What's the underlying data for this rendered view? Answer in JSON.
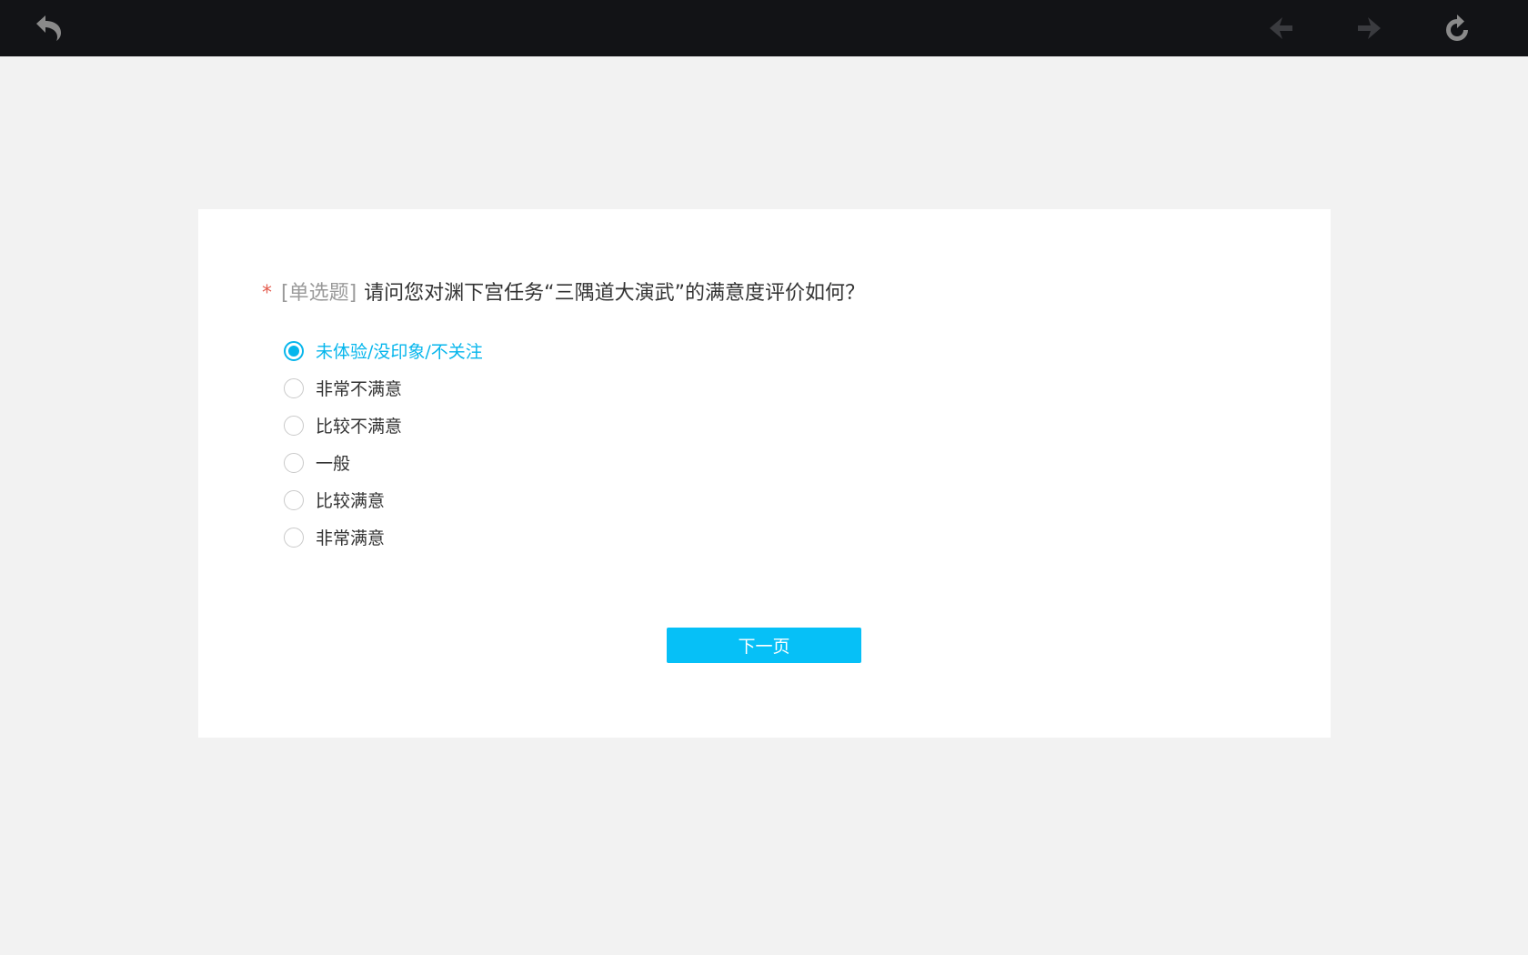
{
  "toolbar": {
    "back_icon": "undo-arrow-icon",
    "prev_icon": "arrow-left-icon",
    "next_icon": "arrow-right-icon",
    "refresh_icon": "refresh-icon",
    "background_color": "#121316"
  },
  "question": {
    "required_mark": "*",
    "type_label": "[单选题]",
    "text": "请问您对渊下宫任务“三隅道大演武”的满意度评价如何？",
    "options": [
      {
        "label": "未体验/没印象/不关注",
        "selected": true
      },
      {
        "label": "非常不满意",
        "selected": false
      },
      {
        "label": "比较不满意",
        "selected": false
      },
      {
        "label": "一般",
        "selected": false
      },
      {
        "label": "比较满意",
        "selected": false
      },
      {
        "label": "非常满意",
        "selected": false
      }
    ]
  },
  "next_button": {
    "label": "下一页"
  },
  "colors": {
    "accent": "#06c0f7",
    "required": "#e45d4f",
    "page_background": "#f2f2f2"
  }
}
